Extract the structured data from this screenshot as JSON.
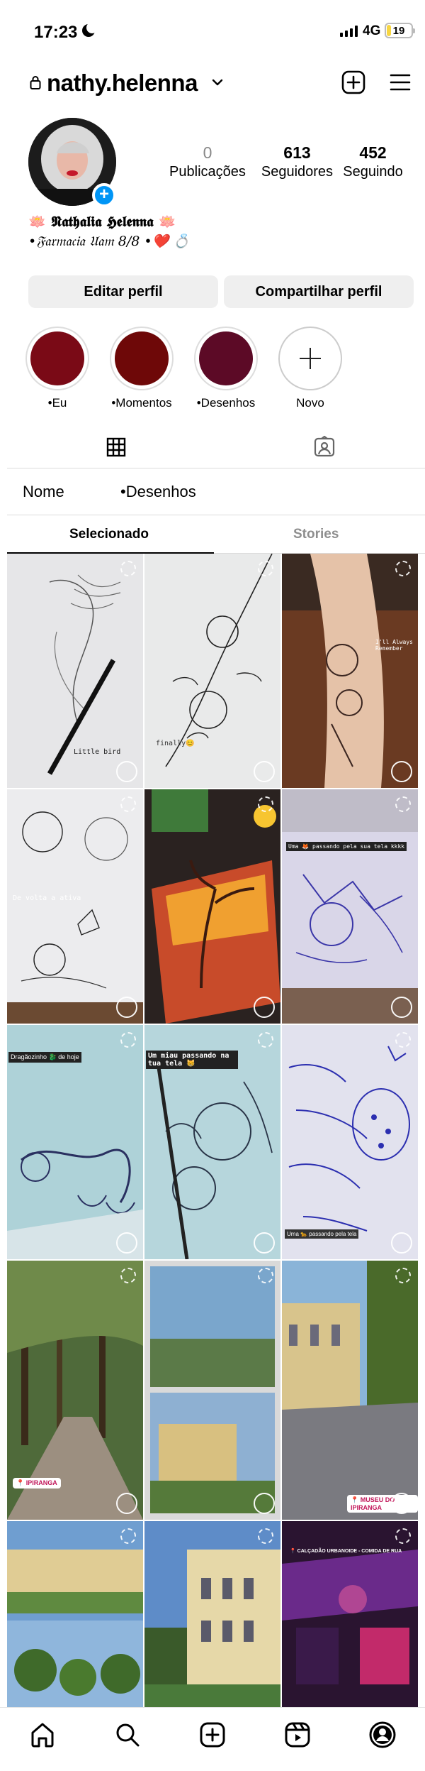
{
  "status_bar": {
    "time": "17:23",
    "network": "4G",
    "battery": "19",
    "battery_level": 0.19
  },
  "header": {
    "username": "nathy.helenna"
  },
  "stats": [
    {
      "value": "0",
      "label": "Publicações"
    },
    {
      "value": "613",
      "label": "Seguidores"
    },
    {
      "value": "452",
      "label": "Seguindo"
    }
  ],
  "bio": {
    "name": "🪷 𝕹𝖆𝖙𝖍𝖆𝖑𝖎𝖆 𝕳𝖊𝖑𝖊𝖓𝖓𝖆 🪷",
    "line": "•𝔉𝔞𝔯𝔪𝔞𝔠𝔦𝔞 𝔘𝔞𝔪 8/8 •❤️ 💍"
  },
  "buttons": {
    "edit": "Editar perfil",
    "share": "Compartilhar perfil"
  },
  "highlights": [
    {
      "label": "•Eu",
      "color": "#7a0a16"
    },
    {
      "label": "•Momentos",
      "color": "#6e0808"
    },
    {
      "label": "•Desenhos",
      "color": "#5c0a26"
    },
    {
      "label": "Novo"
    }
  ],
  "filter": {
    "name_label": "Nome",
    "collection": "•Desenhos"
  },
  "subtabs": {
    "selected": "Selecionado",
    "other": "Stories"
  },
  "posts": [
    {
      "caption": "Little bird"
    },
    {
      "caption": "finally😊"
    },
    {
      "caption": "I'll Always Remember"
    },
    {
      "caption": "De volta a ativa"
    },
    {
      "caption": ""
    },
    {
      "caption": "Uma 🦊 passando pela sua tela kkkk"
    },
    {
      "caption": "Dragãozinho 🐉 de hoje"
    },
    {
      "caption": "Um miau passando na tua tela 😸"
    },
    {
      "caption": "Uma 🐆 passando pela tela"
    },
    {
      "caption": "📍 IPIRANGA"
    },
    {
      "caption": ""
    },
    {
      "caption": "📍 MUSEU DO IPIRANGA"
    },
    {
      "caption": ""
    },
    {
      "caption": ""
    },
    {
      "caption": "📍 CALÇADÃO URBANOIDE - COMIDA DE RUA"
    }
  ],
  "colors": {
    "accent": "#0095f6",
    "button_bg": "#efefef",
    "muted": "#8e8e8e"
  }
}
